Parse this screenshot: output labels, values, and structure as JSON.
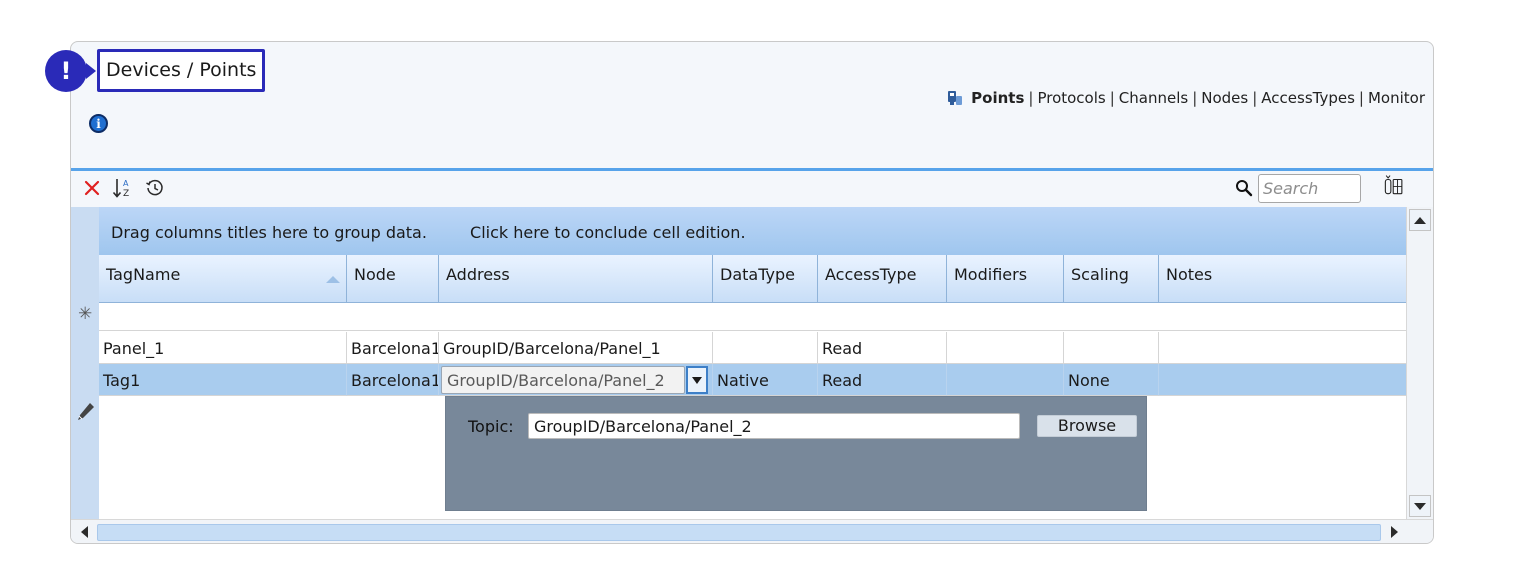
{
  "header": {
    "alert_glyph": "!",
    "page_title": "Devices / Points",
    "info_glyph": "i"
  },
  "nav": {
    "items": [
      {
        "label": "Points",
        "active": true
      },
      {
        "label": "Protocols",
        "active": false
      },
      {
        "label": "Channels",
        "active": false
      },
      {
        "label": "Nodes",
        "active": false
      },
      {
        "label": "AccessTypes",
        "active": false
      },
      {
        "label": "Monitor",
        "active": false
      }
    ],
    "separator": "|"
  },
  "toolbar": {
    "icons": [
      "delete-icon",
      "sort-icon",
      "history-icon",
      "search-icon",
      "column-chooser-icon"
    ],
    "search_placeholder": "Search",
    "search_value": ""
  },
  "grid": {
    "group_hint": "Drag columns titles here to group data.",
    "conclude_hint": "Click here to conclude cell edition.",
    "new_row_marker": "✳",
    "columns": [
      "TagName",
      "Node",
      "Address",
      "DataType",
      "AccessType",
      "Modifiers",
      "Scaling",
      "Notes"
    ],
    "sorted_column": "TagName",
    "rows": [
      {
        "TagName": "Panel_1",
        "Node": "Barcelona1",
        "Address": "GroupID/Barcelona/Panel_1",
        "DataType": "",
        "AccessType": "Read",
        "Modifiers": "",
        "Scaling": "",
        "Notes": ""
      },
      {
        "TagName": "Tag1",
        "Node": "Barcelona1",
        "Address": "GroupID/Barcelona/Panel_2",
        "DataType": "Native",
        "AccessType": "Read",
        "Modifiers": "",
        "Scaling": "None",
        "Notes": ""
      }
    ],
    "editing_row_index": 1
  },
  "address_popup": {
    "topic_label": "Topic:",
    "topic_value": "GroupID/Barcelona/Panel_2",
    "browse_label": "Browse"
  },
  "colors": {
    "accent": "#2a2ab8",
    "selected_row": "#a9ccee",
    "header_gradient_top": "#eaf3ff",
    "popup_bg": "#78889a",
    "divider": "#57a3ea"
  }
}
